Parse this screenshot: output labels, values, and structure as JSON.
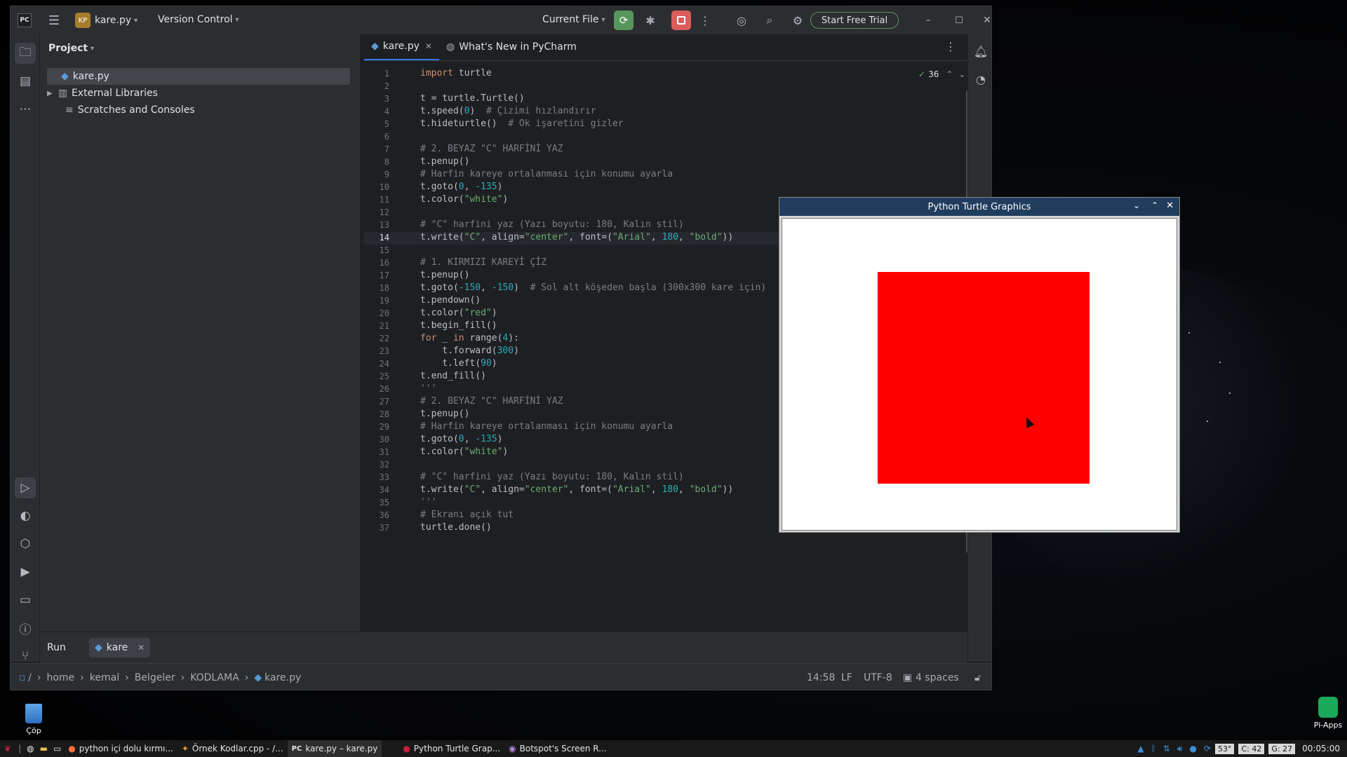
{
  "ide": {
    "logo": "PC",
    "project_badge": "KP",
    "project_name": "kare.py",
    "version_control": "Version Control",
    "run_config": "Current File",
    "start_trial": "Start Free Trial",
    "tabs": [
      {
        "label": "kare.py"
      },
      {
        "label": "What's New in PyCharm"
      }
    ],
    "inspection_count": "36",
    "project_panel": {
      "title": "Project",
      "items": [
        {
          "label": "kare.py"
        },
        {
          "label": "External Libraries"
        },
        {
          "label": "Scratches and Consoles"
        }
      ]
    },
    "run_panel": {
      "title": "Run",
      "tab": "kare"
    },
    "breadcrumb": [
      "home",
      "kemal",
      "Belgeler",
      "KODLAMA",
      "kare.py"
    ],
    "status": {
      "position": "14:58",
      "line_sep": "LF",
      "encoding": "UTF-8",
      "indent": "4 spaces"
    },
    "current_line": "14"
  },
  "code_lines": [
    "import turtle",
    "",
    "t = turtle.Turtle()",
    "t.speed(0)  # Çizimi hızlandırır",
    "t.hideturtle()  # Ok işaretini gizler",
    "",
    "# 2. BEYAZ \"C\" HARFİNİ YAZ",
    "t.penup()",
    "# Harfin kareye ortalanması için konumu ayarla",
    "t.goto(0, -135)",
    "t.color(\"white\")",
    "",
    "# \"C\" harfini yaz (Yazı boyutu: 180, Kalın stil)",
    "t.write(\"C\", align=\"center\", font=(\"Arial\", 180, \"bold\"))",
    "",
    "# 1. KIRMIZI KAREYİ ÇİZ",
    "t.penup()",
    "t.goto(-150, -150)  # Sol alt köşeden başla (300x300 kare için)",
    "t.pendown()",
    "t.color(\"red\")",
    "t.begin_fill()",
    "for _ in range(4):",
    "    t.forward(300)",
    "    t.left(90)",
    "t.end_fill()",
    "'''",
    "# 2. BEYAZ \"C\" HARFİNİ YAZ",
    "t.penup()",
    "# Harfin kareye ortalanması için konumu ayarla",
    "t.goto(0, -135)",
    "t.color(\"white\")",
    "",
    "# \"C\" harfini yaz (Yazı boyutu: 180, Kalın stil)",
    "t.write(\"C\", align=\"center\", font=(\"Arial\", 180, \"bold\"))",
    "'''",
    "# Ekranı açık tut",
    "turtle.done()"
  ],
  "line_numbers": [
    "1",
    "2",
    "3",
    "4",
    "5",
    "6",
    "7",
    "8",
    "9",
    "10",
    "11",
    "12",
    "13",
    "14",
    "15",
    "16",
    "17",
    "18",
    "19",
    "20",
    "21",
    "22",
    "23",
    "24",
    "25",
    "26",
    "27",
    "28",
    "29",
    "30",
    "31",
    "32",
    "33",
    "34",
    "35",
    "36",
    "37"
  ],
  "turtle_window": {
    "title": "Python Turtle Graphics",
    "square_color": "#ff0000"
  },
  "desktop": {
    "trash_label": "Çöp",
    "pi_apps_label": "Pi-Apps"
  },
  "taskbar": {
    "tasks": [
      {
        "label": "python içi dolu kırmı..."
      },
      {
        "label": "Örnek Kodlar.cpp - /..."
      },
      {
        "label": "kare.py – kare.py"
      },
      {
        "label": "Python Turtle Grap..."
      },
      {
        "label": "Botspot's Screen R..."
      }
    ],
    "temp": "53°",
    "cpu": "C: 42",
    "gpu": "G: 27",
    "clock": "00:05:00"
  },
  "colors": {
    "accent": "#3574f0",
    "run_green": "#57965c",
    "stop_red": "#db5c5c",
    "trial_border": "#57965c"
  }
}
